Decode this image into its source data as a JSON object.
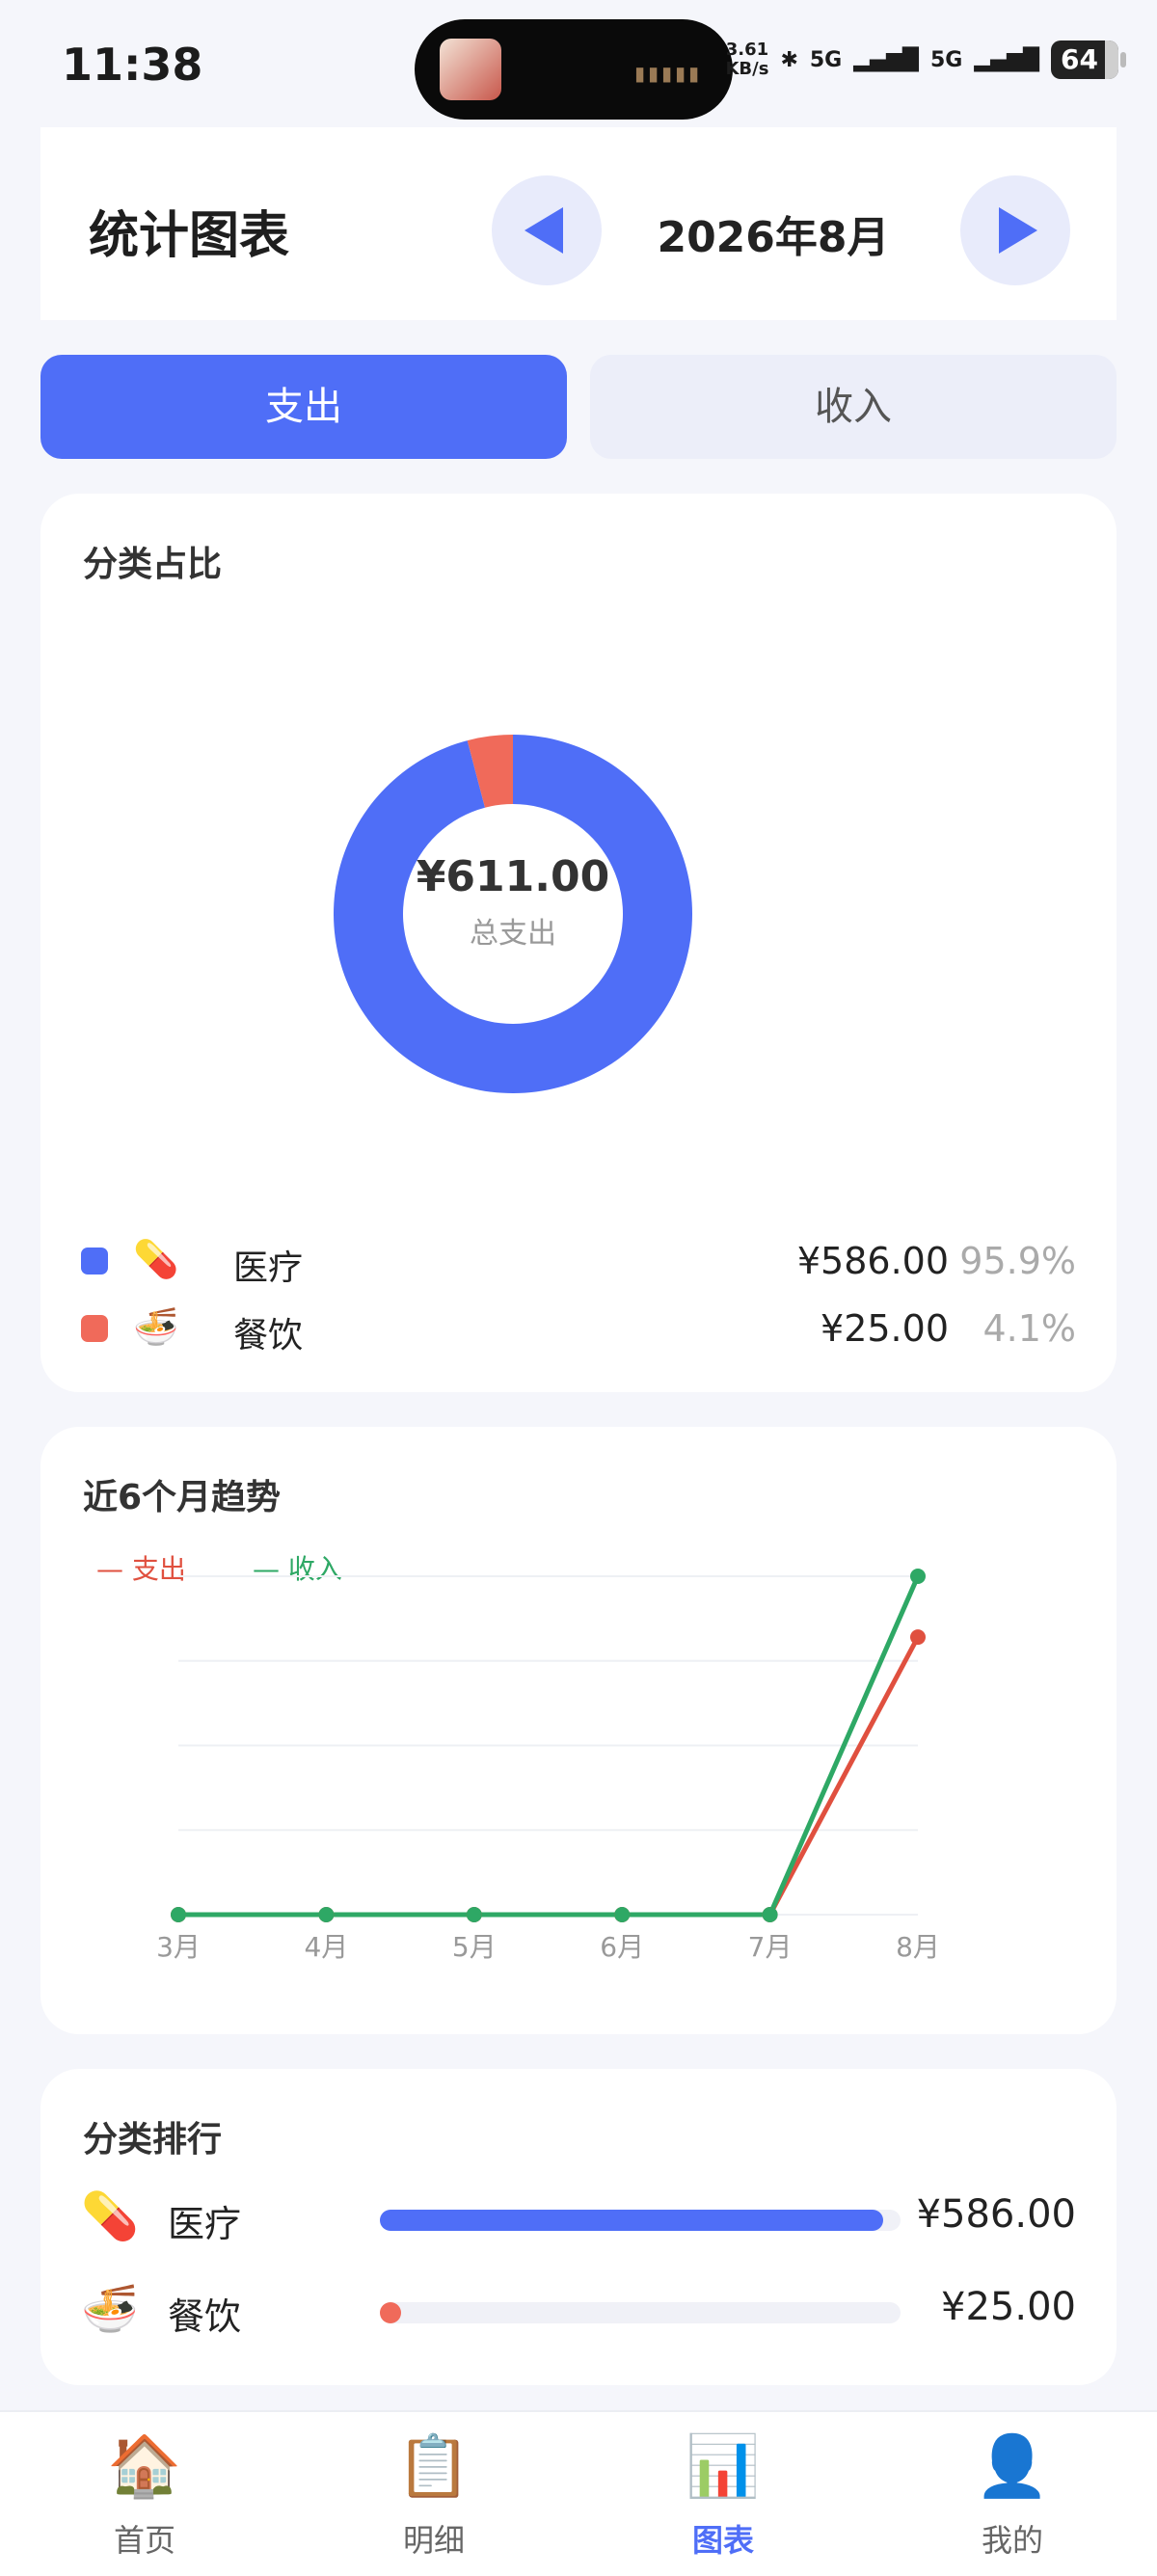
{
  "status_bar": {
    "time": "11:38",
    "net_speed": "3.61",
    "net_unit": "KB/s",
    "network_1": "5G",
    "network_2": "5G",
    "battery": "64"
  },
  "header": {
    "title": "统计图表",
    "month": "2026年8月",
    "prev_icon": "triangle-left-icon",
    "next_icon": "triangle-right-icon"
  },
  "tabs": {
    "expense": "支出",
    "income": "收入",
    "selected": "支出"
  },
  "category_share": {
    "title": "分类占比",
    "total_amount": "¥611.00",
    "total_label": "总支出",
    "items": [
      {
        "icon": "💊",
        "name": "医疗",
        "amount": "¥586.00",
        "percent": "95.9%",
        "color": "#4f6ef7"
      },
      {
        "icon": "🍜",
        "name": "餐饮",
        "amount": "¥25.00",
        "percent": "4.1%",
        "color": "#f06a5a"
      }
    ]
  },
  "trend": {
    "title": "近6个月趋势",
    "legend_expense": "— 支出",
    "legend_income": "— 收入"
  },
  "ranking": {
    "title": "分类排行",
    "items": [
      {
        "icon": "💊",
        "name": "医疗",
        "amount": "¥586.00",
        "ratio": 1.0,
        "color": "#4f6ef7"
      },
      {
        "icon": "🍜",
        "name": "餐饮",
        "amount": "¥25.00",
        "ratio": 0.043,
        "color": "#f06a5a"
      }
    ]
  },
  "tab_bar": {
    "items": [
      {
        "icon": "🏠",
        "label": "首页"
      },
      {
        "icon": "📋",
        "label": "明细"
      },
      {
        "icon": "📊",
        "label": "图表"
      },
      {
        "icon": "👤",
        "label": "我的"
      }
    ],
    "active": "图表"
  },
  "chart_data": [
    {
      "type": "pie",
      "title": "分类占比",
      "categories": [
        "医疗",
        "餐饮"
      ],
      "values": [
        586.0,
        25.0
      ],
      "colors": [
        "#4f6ef7",
        "#f06a5a"
      ],
      "center_label": "¥611.00",
      "center_sublabel": "总支出"
    },
    {
      "type": "line",
      "title": "近6个月趋势",
      "categories": [
        "3月",
        "4月",
        "5月",
        "6月",
        "7月",
        "8月"
      ],
      "series": [
        {
          "name": "支出",
          "values": [
            0,
            0,
            0,
            0,
            0,
            611
          ],
          "color": "#e0503f"
        },
        {
          "name": "收入",
          "values": [
            0,
            0,
            0,
            0,
            0,
            745
          ],
          "color": "#2ea865"
        }
      ],
      "ylim": [
        0,
        745
      ],
      "grid": true,
      "legend": "top-left"
    }
  ]
}
